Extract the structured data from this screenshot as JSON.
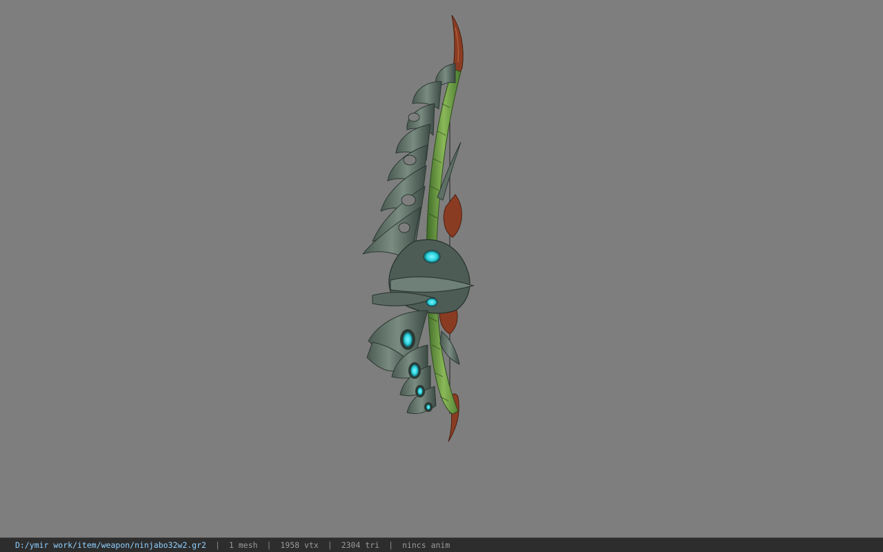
{
  "viewer": {
    "background_color": "#7e7e7e"
  },
  "model": {
    "object": "bow-weapon-model",
    "colors": {
      "blade": "#5e6f66",
      "blade_dark": "#3c4a44",
      "spine": "#5e8f3a",
      "spine_light": "#8ab858",
      "horn": "#8a3c22",
      "gem": "#2fd6e0",
      "string": "#3a3a3a"
    }
  },
  "statusbar": {
    "file_path": "D:/ymir work/item/weapon/ninjabo32w2.gr2",
    "separator": "|",
    "mesh_count": "1 mesh",
    "vertex_count": "1958 vtx",
    "triangle_count": "2304 tri",
    "anim_status": "nincs anim"
  }
}
